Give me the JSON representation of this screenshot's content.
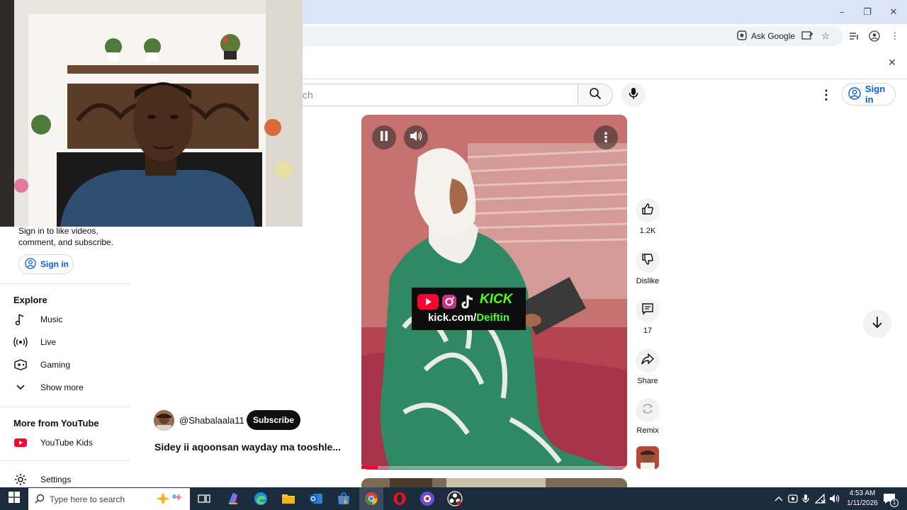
{
  "browser": {
    "ask_google_label": "Ask Google"
  },
  "youtube": {
    "search_placeholder": "ch",
    "header_signin_label": "Sign in"
  },
  "sidebar": {
    "signin_prompt": "Sign in to like videos, comment, and subscribe.",
    "signin_label": "Sign in",
    "explore_heading": "Explore",
    "explore_items": [
      {
        "label": "Music",
        "icon": "music-note-icon"
      },
      {
        "label": "Live",
        "icon": "live-broadcast-icon"
      },
      {
        "label": "Gaming",
        "icon": "gamepad-icon"
      },
      {
        "label": "Show more",
        "icon": "chevron-down-icon"
      }
    ],
    "more_heading": "More from YouTube",
    "more_items": [
      {
        "label": "YouTube Kids",
        "icon": "youtube-kids-icon",
        "color": "#ff0033"
      }
    ],
    "settings_label": "Settings"
  },
  "player": {
    "overlay_brand": "KICK",
    "overlay_url_prefix": "kick.com/",
    "overlay_url_name": "Deiftin",
    "progress_fraction": 0.06
  },
  "actions": {
    "like_count": "1.2K",
    "dislike_label": "Dislike",
    "comment_count": "17",
    "share_label": "Share",
    "remix_label": "Remix"
  },
  "channel": {
    "handle": "@Shabalaala11",
    "subscribe_label": "Subscribe",
    "video_title": "Sidey ii aqoonsan wayday ma tooshle..."
  },
  "taskbar": {
    "search_placeholder": "Type here to search",
    "time": "4:53 AM",
    "date": "1/11/2026",
    "notification_count": "1"
  },
  "colors": {
    "youtube_red": "#ff0033",
    "link_blue": "#065fd4",
    "kick_green": "#53fc18",
    "taskbar_bg": "#1c2b3e"
  }
}
